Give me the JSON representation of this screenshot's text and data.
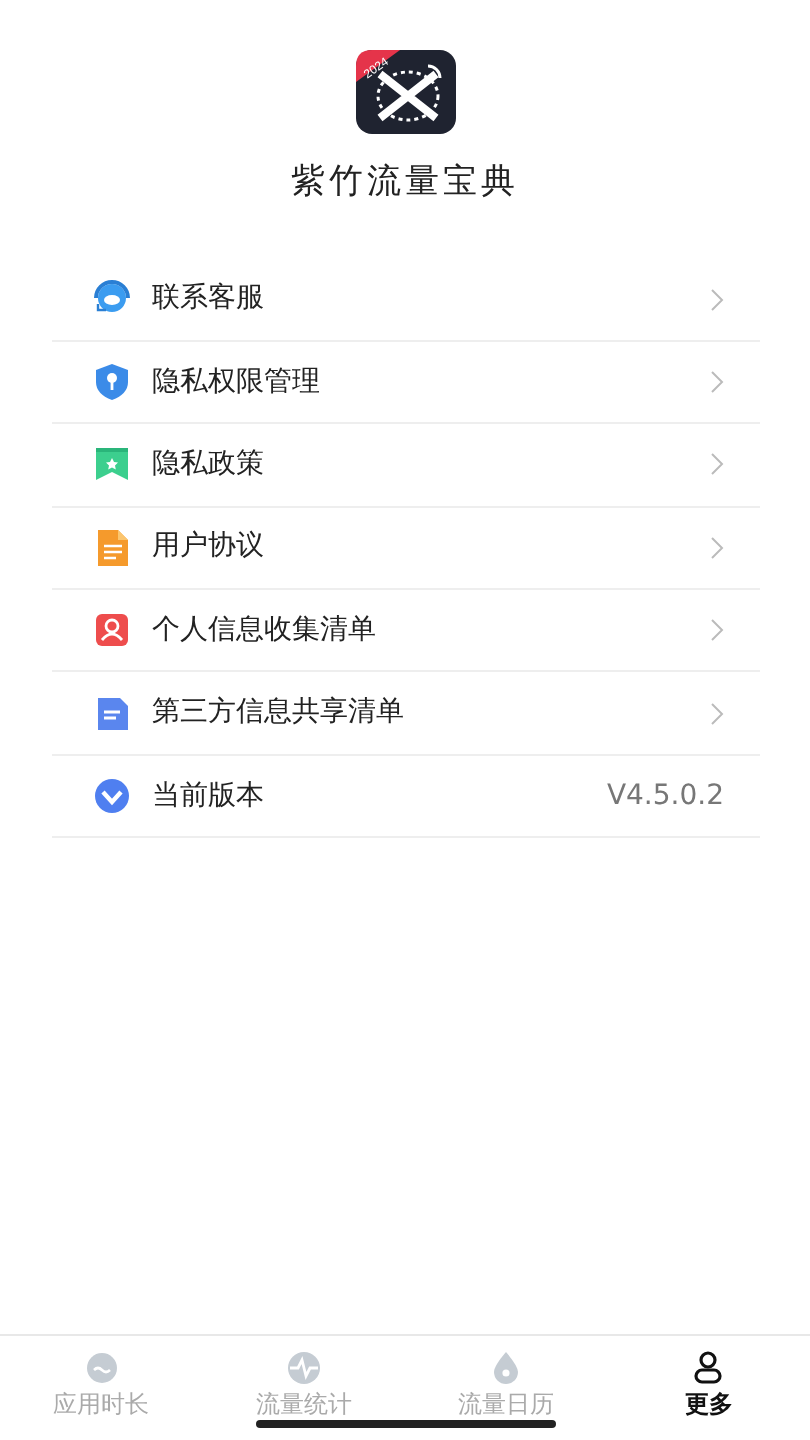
{
  "app": {
    "logo_badge": "2024",
    "name": "紫竹流量宝典"
  },
  "menu": [
    {
      "label": "联系客服",
      "kind": "link"
    },
    {
      "label": "隐私权限管理",
      "kind": "link"
    },
    {
      "label": "隐私政策",
      "kind": "link"
    },
    {
      "label": "用户协议",
      "kind": "link"
    },
    {
      "label": "个人信息收集清单",
      "kind": "link"
    },
    {
      "label": "第三方信息共享清单",
      "kind": "link"
    },
    {
      "label": "当前版本",
      "kind": "version",
      "value": "V4.5.0.2"
    }
  ],
  "tabs": [
    {
      "label": "应用时长",
      "selected": false
    },
    {
      "label": "流量统计",
      "selected": false
    },
    {
      "label": "流量日历",
      "selected": false
    },
    {
      "label": "更多",
      "selected": true
    }
  ]
}
